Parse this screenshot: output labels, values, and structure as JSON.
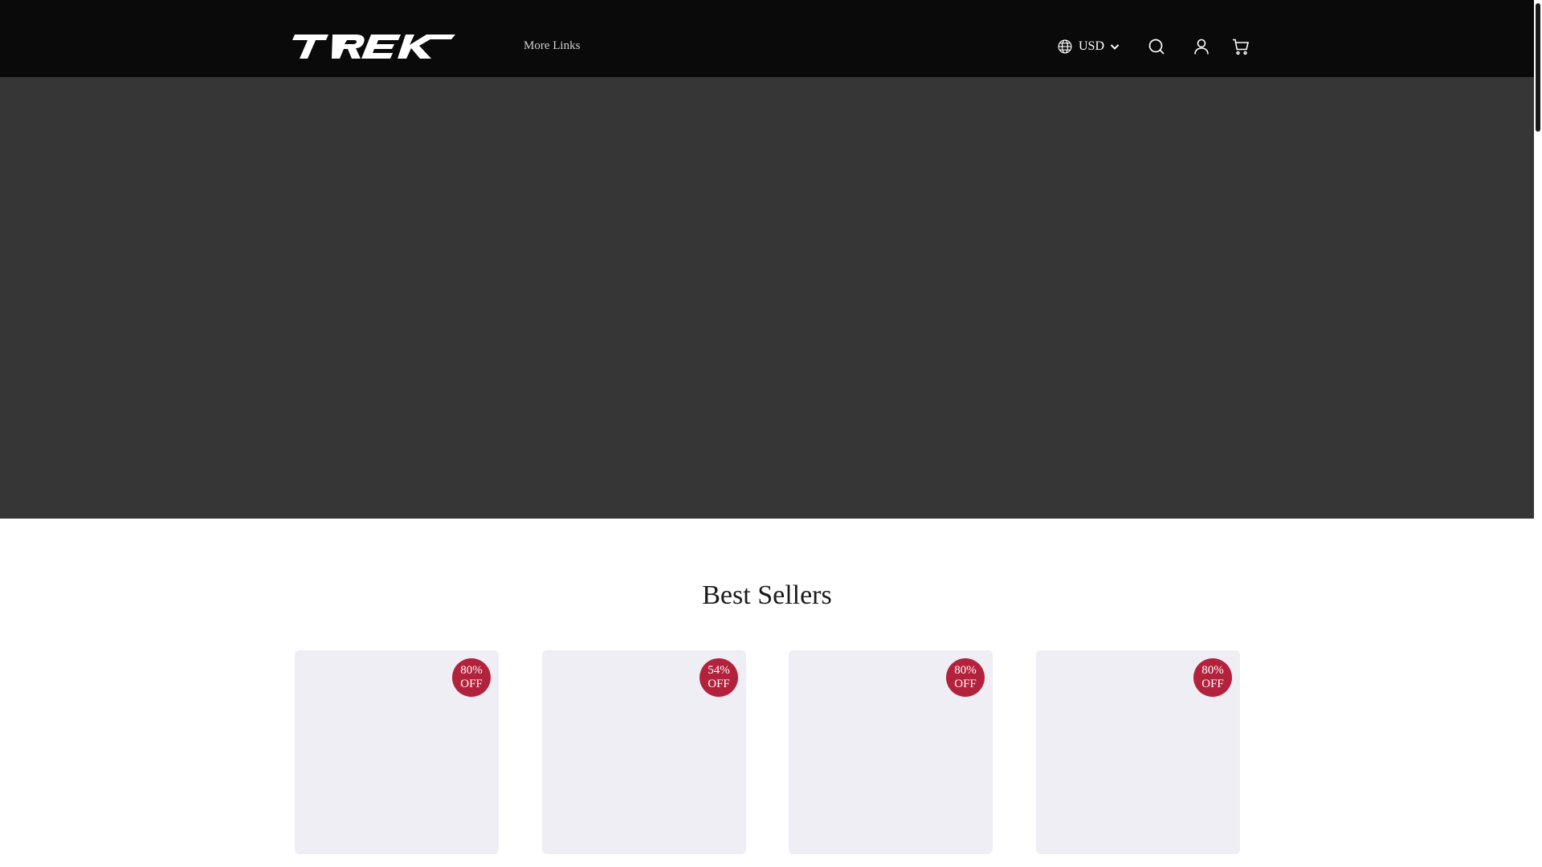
{
  "header": {
    "logo_text": "TREK",
    "nav_link": "More Links",
    "currency": "USD",
    "icons": {
      "currency": "globe-icon",
      "dropdown": "chevron-down-icon",
      "search": "search-icon",
      "account": "user-icon",
      "cart": "cart-icon"
    }
  },
  "best_sellers": {
    "title": "Best Sellers",
    "products": [
      {
        "discount_pct": "80%",
        "discount_suffix": "OFF"
      },
      {
        "discount_pct": "54%",
        "discount_suffix": "OFF"
      },
      {
        "discount_pct": "80%",
        "discount_suffix": "OFF"
      },
      {
        "discount_pct": "80%",
        "discount_suffix": "OFF"
      }
    ]
  },
  "colors": {
    "header_bg": "#0a0a0a",
    "hero_bg": "#363636",
    "card_bg": "#eeeef4",
    "badge_bg": "#b3223c"
  }
}
